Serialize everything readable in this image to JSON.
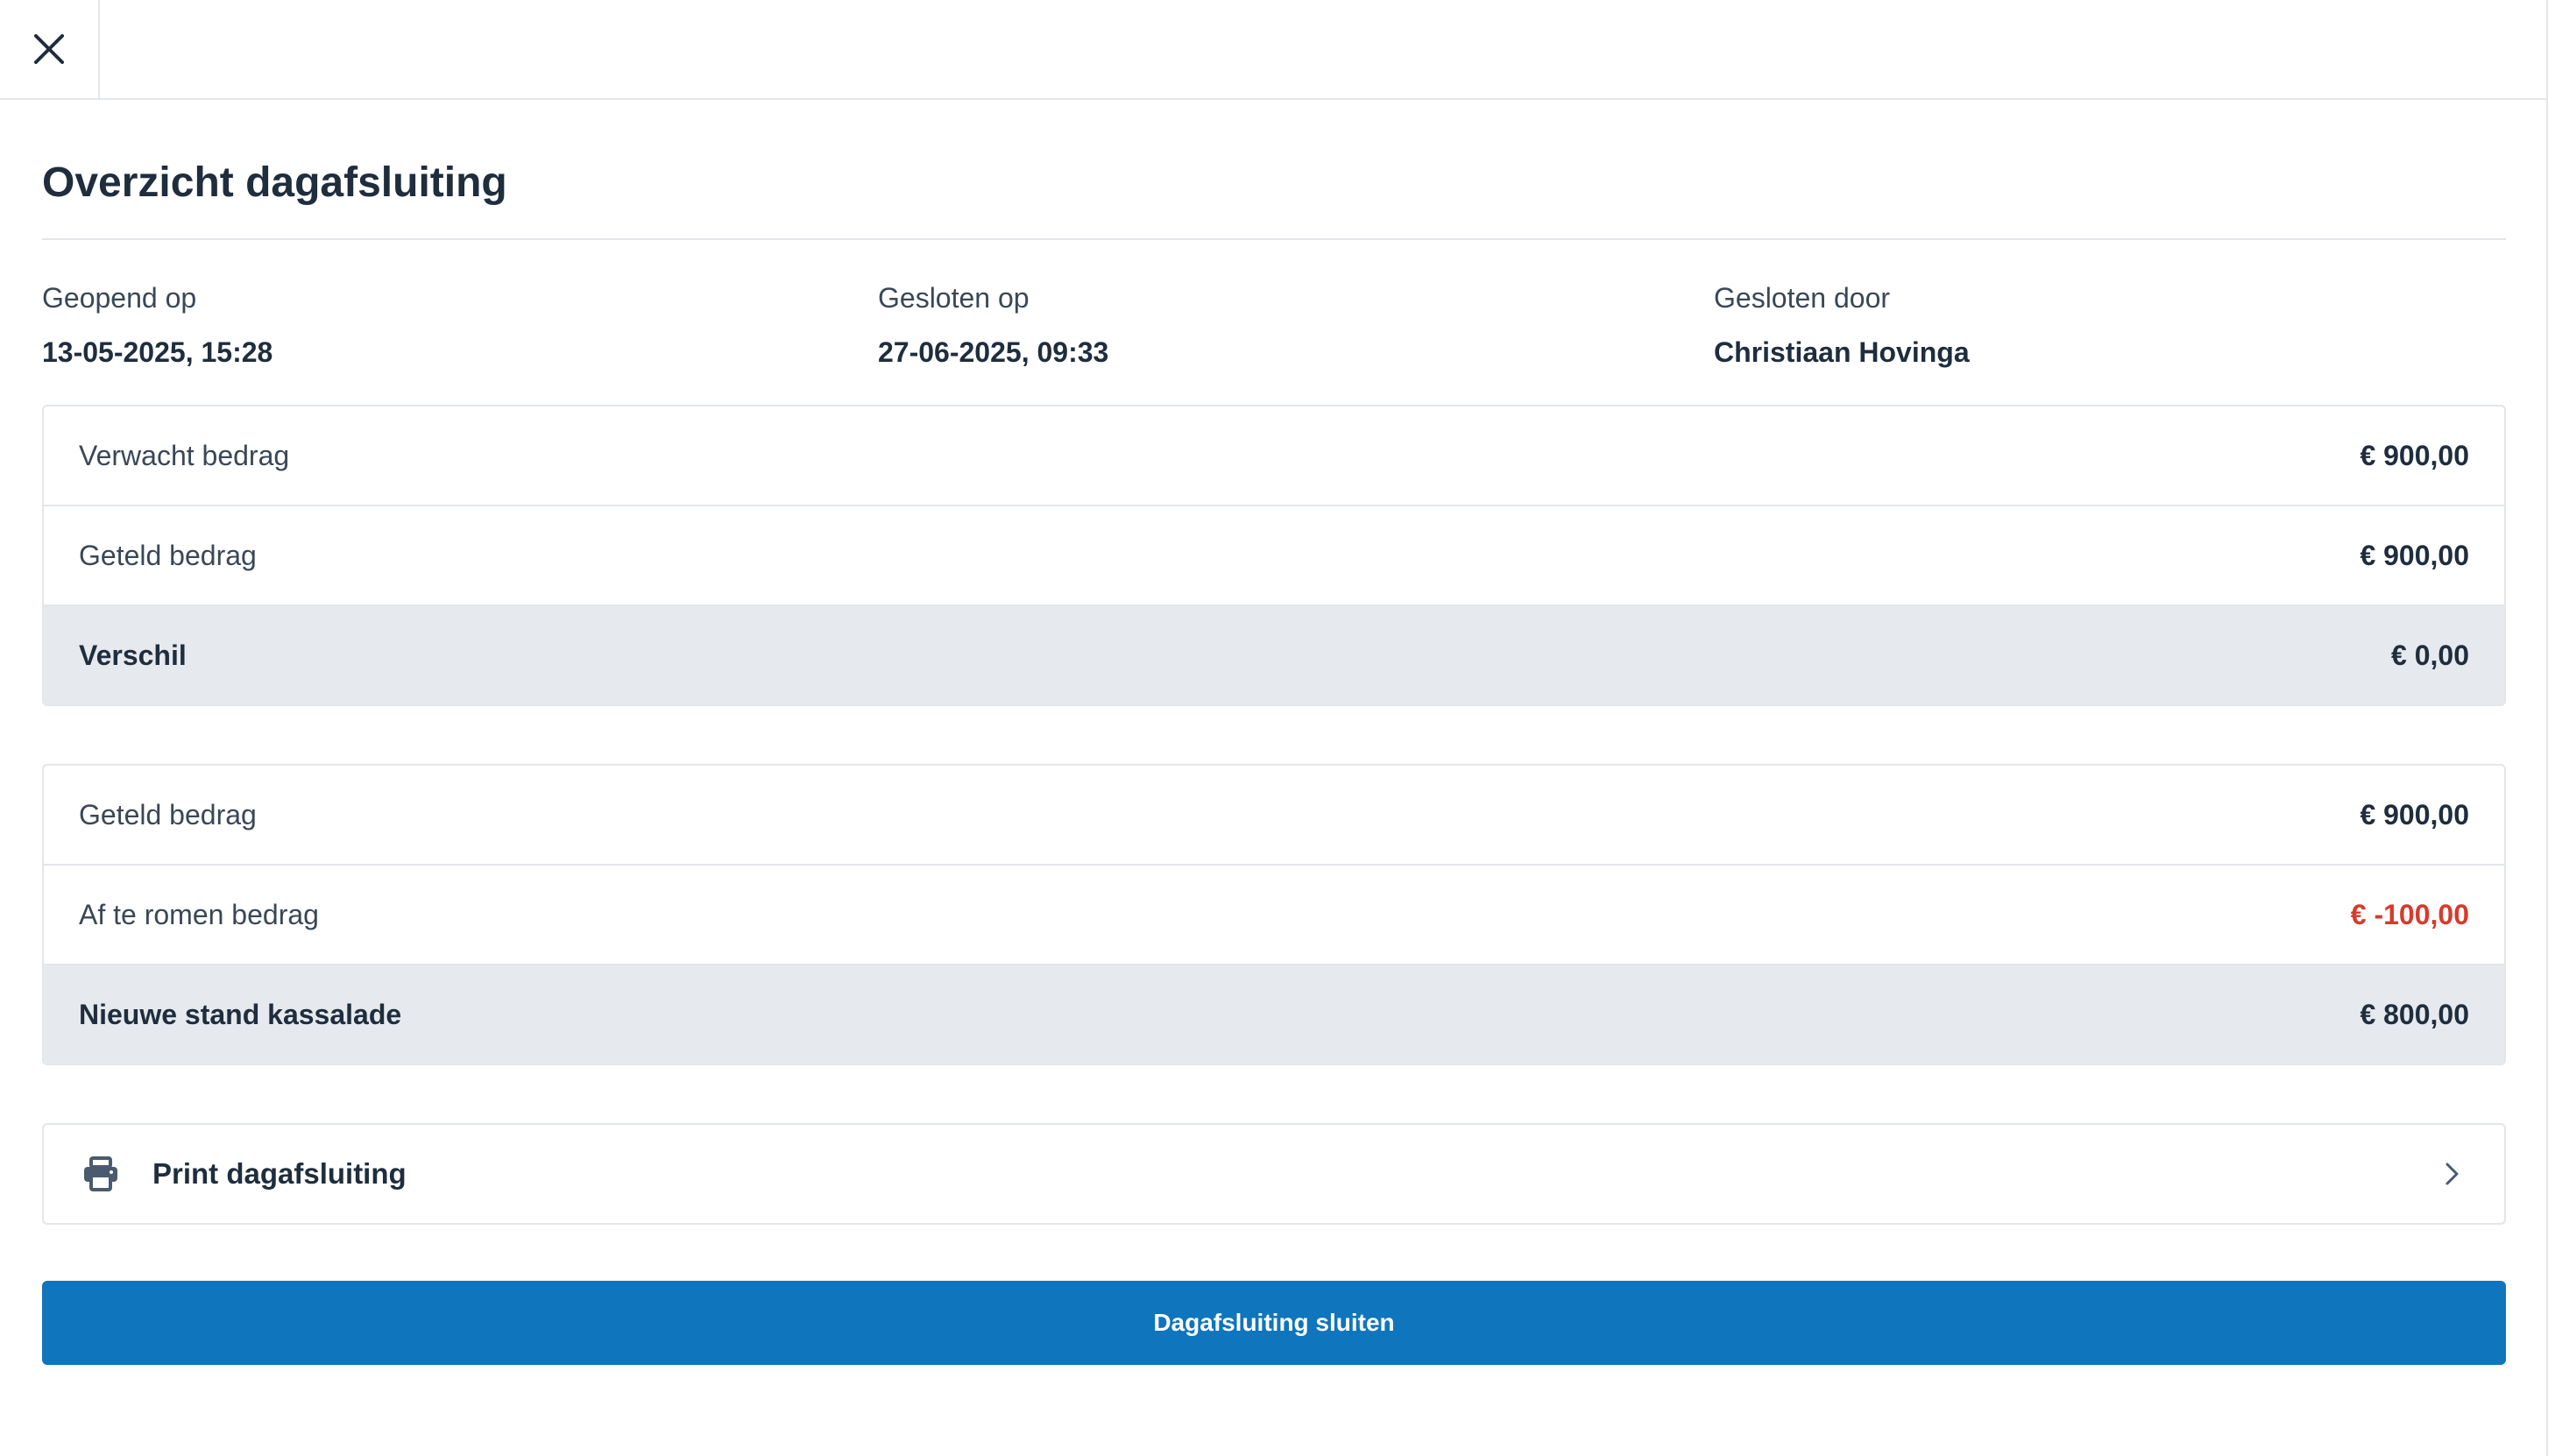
{
  "header": {
    "close_icon": "close-icon"
  },
  "page": {
    "title": "Overzicht dagafsluiting"
  },
  "meta": [
    {
      "label": "Geopend op",
      "value": "13-05-2025, 15:28"
    },
    {
      "label": "Gesloten op",
      "value": "27-06-2025, 09:33"
    },
    {
      "label": "Gesloten door",
      "value": "Christiaan Hovinga"
    }
  ],
  "summary": {
    "expected": {
      "label": "Verwacht bedrag",
      "value": "€ 900,00"
    },
    "counted": {
      "label": "Geteld bedrag",
      "value": "€ 900,00"
    },
    "difference": {
      "label": "Verschil",
      "value": "€ 0,00"
    }
  },
  "drawer": {
    "counted": {
      "label": "Geteld bedrag",
      "value": "€ 900,00"
    },
    "skim": {
      "label": "Af te romen bedrag",
      "value": "€ -100,00"
    },
    "new_balance": {
      "label": "Nieuwe stand kassalade",
      "value": "€ 800,00"
    }
  },
  "print": {
    "label": "Print dagafsluiting",
    "icon": "printer-icon",
    "chevron": "chevron-right-icon"
  },
  "actions": {
    "close_day_label": "Dagafsluiting sluiten"
  },
  "colors": {
    "primary": "#0f75bc",
    "negative": "#d63b2c",
    "total_bg": "#e6e9ee",
    "border": "#e3e6ea"
  }
}
